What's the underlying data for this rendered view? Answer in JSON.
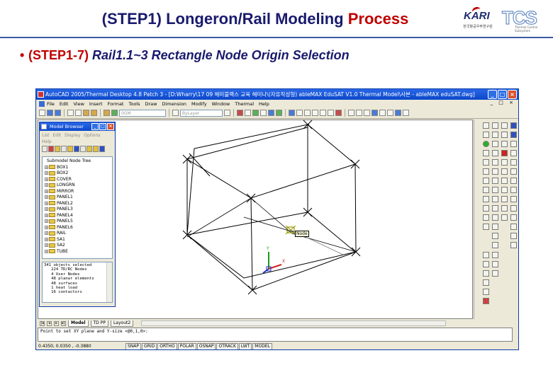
{
  "slide": {
    "title_main": "(STEP1) Longeron/Rail Modeling ",
    "title_accent": "Process",
    "bullet_mark": "•",
    "bullet_step": "(STEP1-7) ",
    "bullet_text": "Rail1.1~3 Rectangle Node Origin Selection",
    "logo_kari": "KARI",
    "logo_kari_sub": "한국항공우주연구원",
    "logo_tcs": "TCS",
    "logo_tcs_sub": "Thermal Control Subsystem"
  },
  "window": {
    "title": "AutoCAD 2005/Thermal Desktop 4.8 Patch 3 - [D:Wharry\\17 09 해미불랙스 교육 해미나\\(자유직성형) ableMAX EduSAT V1.0 Thermal Model\\사본 - ableMAX eduSAT.dwg]",
    "min": "_",
    "max": "□",
    "close": "×"
  },
  "menu": [
    "File",
    "Edit",
    "View",
    "Insert",
    "Format",
    "Tools",
    "Draw",
    "Dimension",
    "Modify",
    "Window",
    "Thermal",
    "Help"
  ],
  "menu_right": "_ □ ×",
  "toolbar": {
    "layer_combo": "0GM",
    "linetype_combo": "ByLayer"
  },
  "browser": {
    "title": "Model Browser",
    "menu": [
      "List",
      "Edit",
      "Display",
      "Options",
      "Help"
    ],
    "tree_root": "Submodel Node Tree",
    "tree_items": [
      "BOX1",
      "BOX2",
      "COVER",
      "LONGRN",
      "MIRROR",
      "PANEL1",
      "PANEL2",
      "PANEL3",
      "PANEL4",
      "PANEL5",
      "PANEL6",
      "RAIL",
      "SA1",
      "SA2",
      "TUBE"
    ],
    "info_lines": [
      "341 objects selected",
      "   224 TD/RC Nodes",
      "   4 User Nodes",
      "   48 planar elements",
      "   48 surfaces",
      "   1 heat load",
      "   16 contactors"
    ]
  },
  "drawing": {
    "snap_tooltip": "Node",
    "axis_x": "X",
    "axis_y": "Y"
  },
  "tabs": {
    "model": "Model",
    "td_pp": "TD PP",
    "layout2": "Layout2"
  },
  "command_line": "Point to set XY plane and Y-size <@0,1,0>:",
  "status": {
    "coords": "0.4350,  0.0350 , -0.3880",
    "buttons": [
      "SNAP",
      "GRID",
      "ORTHO",
      "POLAR",
      "OSNAP",
      "OTRACK",
      "LWT",
      "MODEL"
    ]
  }
}
